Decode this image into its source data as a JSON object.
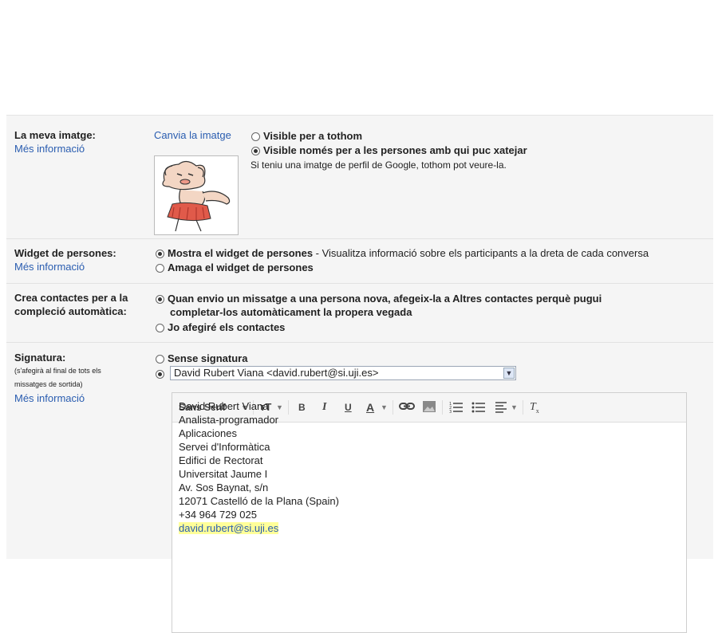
{
  "picture": {
    "label": "La meva imatge:",
    "more": "Més informació",
    "change_link": "Canvia la imatge",
    "opt1": "Visible per a tothom",
    "opt2": "Visible només per a les persones amb qui puc xatejar",
    "note": "Si teniu una imatge de perfil de Google, tothom pot veure-la.",
    "avatar_icon": "cartoon-avatar-icon"
  },
  "widget": {
    "label": "Widget de persones:",
    "more": "Més informació",
    "opt1_bold": "Mostra el widget de persones",
    "opt1_rest": " - Visualitza informació sobre els participants a la dreta de cada conversa",
    "opt2": "Amaga el widget de persones"
  },
  "contacts": {
    "label_line1": "Crea contactes per a la",
    "label_line2": "compleció automàtica:",
    "opt1_line1": "Quan envio un missatge a una persona nova, afegeix-la a Altres contactes perquè pugui",
    "opt1_line2": "completar-los automàticament la propera vegada",
    "opt2": "Jo afegiré els contactes"
  },
  "signature": {
    "label": "Signatura:",
    "note_line1": "(s'afegirà al final de tots els",
    "note_line2": "missatges de sortida)",
    "more": "Més informació",
    "opt_none": "Sense signatura",
    "selected_account": "David Rubert Viana <david.rubert@si.uji.es>",
    "toolbar": {
      "font": "Sans Serif",
      "size_icon": "font-size-icon",
      "bold": "B",
      "italic": "I",
      "underline": "U",
      "text_color": "A",
      "link_icon": "link-icon",
      "image_icon": "image-icon",
      "numbered_list_icon": "numbered-list-icon",
      "bullet_list_icon": "bullet-list-icon",
      "align_icon": "align-icon",
      "clear_format_icon": "remove-formatting-icon"
    },
    "lines": [
      "David Rubert Viana",
      "Analista-programador",
      "Aplicaciones",
      "Servei d'Informàtica",
      "Edifici de Rectorat",
      "Universitat Jaume I",
      "Av. Sos Baynat, s/n",
      "12071 Castelló de la Plana (Spain)",
      "+34 964 729 025"
    ],
    "email": "david.rubert@si.uji.es"
  },
  "colors": {
    "link": "#2a5db0",
    "panel": "#f5f5f5"
  }
}
